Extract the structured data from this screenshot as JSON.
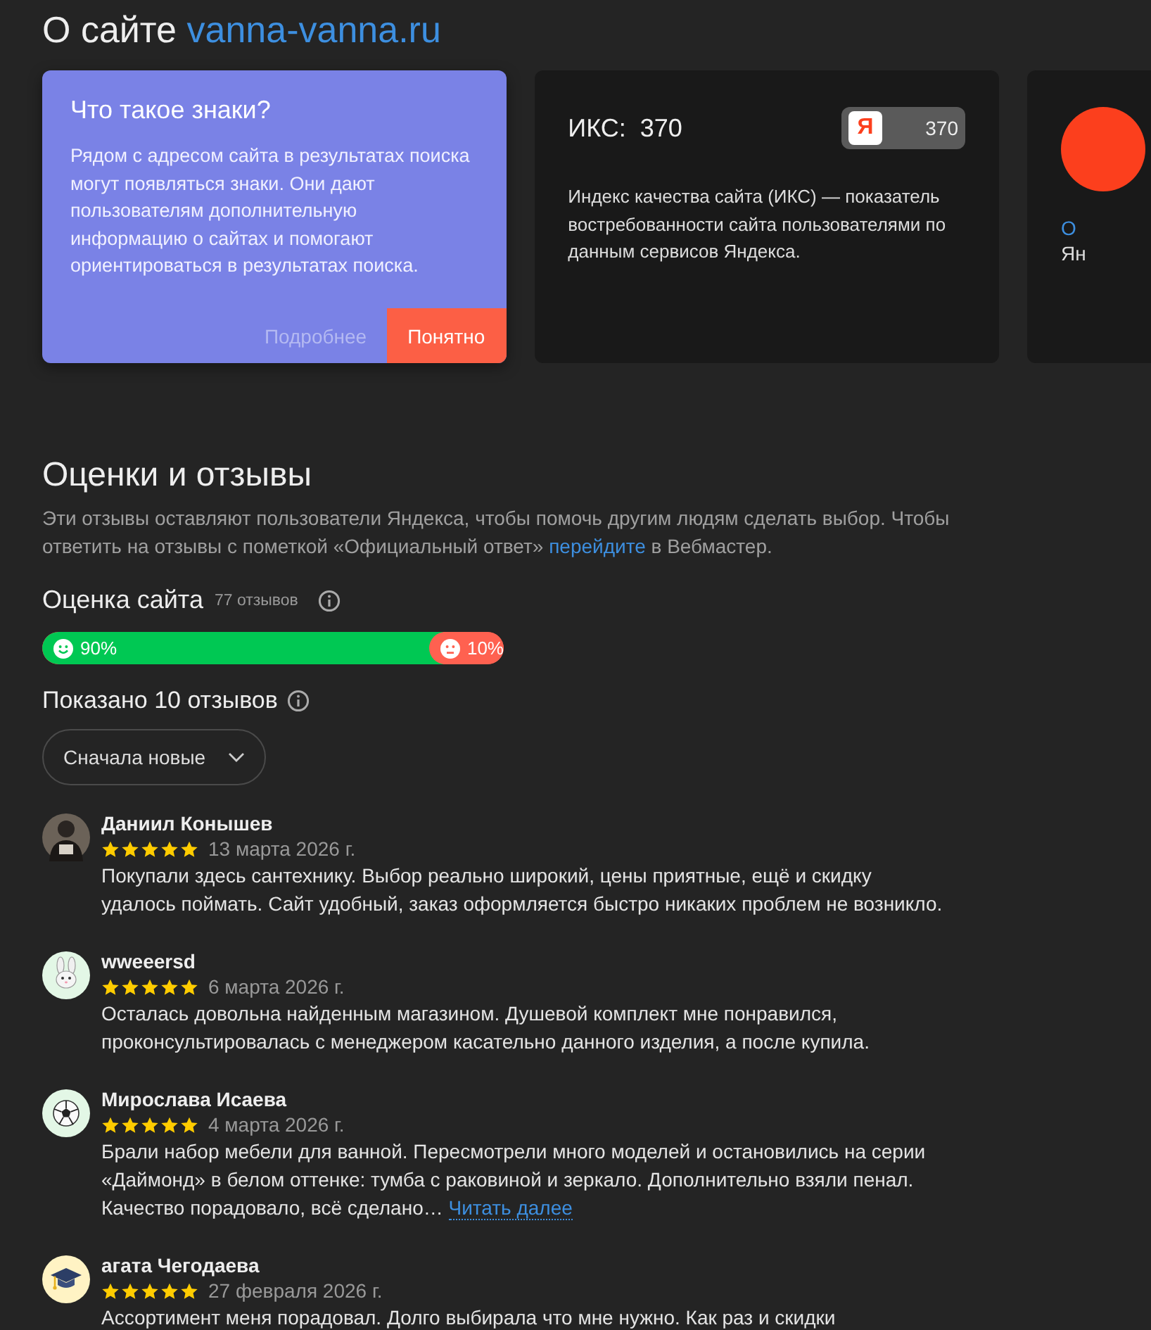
{
  "header": {
    "title": "О сайте",
    "domain": "vanna-vanna.ru"
  },
  "hint_card": {
    "title": "Что такое знаки?",
    "text": "Рядом с адресом сайта в результатах поиска могут появляться знаки. Они дают пользователям дополнительную информацию о сайтах и помогают ориентироваться в результатах поиска.",
    "buttons": [
      {
        "label": "Подробнее",
        "kind": "link"
      },
      {
        "label": "Понятно",
        "kind": "primary"
      }
    ]
  },
  "iks_card": {
    "label": "ИКС:",
    "value": "370",
    "badge_logo": "Я",
    "badge_value": "370",
    "text": "Индекс качества сайта (ИКС) — показатель востребованности сайта пользователями по данным сервисов Яндекса."
  },
  "third_card": {
    "link": "О",
    "text": "Ян"
  },
  "reviews_section": {
    "title": "Оценки и отзывы",
    "description": "Эти отзывы оставляют пользователи Яндекса, чтобы помочь другим людям сделать выбор. Чтобы ответить на отзывы с пометкой «Официальный ответ»",
    "link": "перейдите",
    "description_end": "в Вебмастер."
  },
  "rating": {
    "title": "Оценка сайта",
    "count": "77 отзывов",
    "positive": {
      "label": "90%",
      "level": 0.9
    },
    "negative": {
      "label": "10%"
    }
  },
  "shown": {
    "title": "Показано 10 отзывов"
  },
  "sort": {
    "value": "Сначала новые"
  },
  "reviews": [
    {
      "author": "Даниил Конышев",
      "stars": 5,
      "date": "13 марта 2026 г.",
      "text": "Покупали здесь сантехнику. Выбор реально широкий, цены приятные, ещё и скидку удалось поймать. Сайт удобный, заказ оформляется быстро никаких проблем не возникло."
    },
    {
      "author": "wweeersd",
      "avatar": {
        "kind": "bunny"
      },
      "stars": 5,
      "date": "6 марта 2026 г.",
      "text": "Осталась довольна найденным магазином. Душевой комплект мне понравился, проконсультировалась с менеджером касательно данного изделия, а после купила."
    },
    {
      "author": "Мирослава Исаева",
      "avatar": {
        "kind": "ball"
      },
      "stars": 5,
      "date": "4 марта 2026 г.",
      "text": "Брали набор мебели для ванной. Пересмотрели много моделей и остановились на серии «Даймонд» в белом оттенке: тумба с раковиной и зеркало. Дополнительно взяли пенал. Качество порадовало, всё сделано…",
      "more": "Читать далее"
    },
    {
      "author": "агата Чегодаева",
      "avatar": {
        "kind": "cap"
      },
      "stars": 5,
      "date": "27 февраля 2026 г.",
      "text": "Ассортимент меня порадовал. Долго выбирала что мне нужно. Как раз и скидки"
    }
  ]
}
